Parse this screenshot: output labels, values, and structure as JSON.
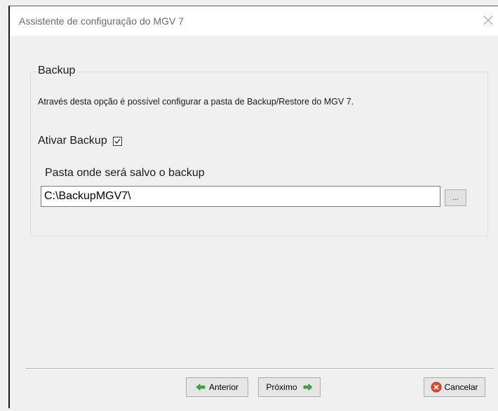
{
  "window": {
    "title": "Assistente de configuração do MGV 7"
  },
  "backup": {
    "group_title": "Backup",
    "description": "Através desta opção é possível configurar a pasta de Backup/Restore do MGV 7.",
    "enable_label": "Ativar Backup",
    "enable_checked": true,
    "path_label": "Pasta onde será salvo o backup",
    "path_value": "C:\\BackupMGV7\\",
    "browse_label": "..."
  },
  "footer": {
    "prev_label": "Anterior",
    "next_label": "Próximo",
    "cancel_label": "Cancelar"
  },
  "colors": {
    "arrow_green": "#3aa843",
    "cancel_red": "#e0452f"
  },
  "icons": {
    "close": "close-icon",
    "prev": "arrow-left-icon",
    "next": "arrow-right-icon",
    "cancel": "cancel-icon",
    "checkbox": "checkmark-icon"
  }
}
